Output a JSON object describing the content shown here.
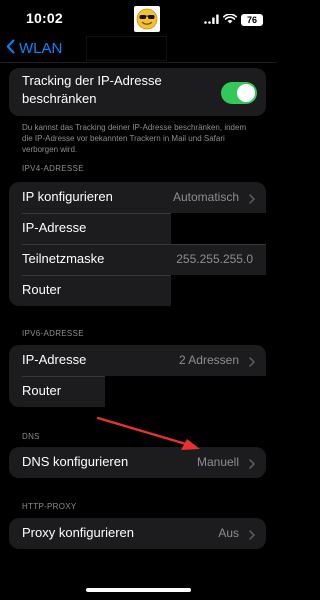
{
  "status_bar": {
    "time": "10:02",
    "emoji_icon": "smiling-face-with-sunglasses",
    "battery": "76"
  },
  "nav": {
    "back_label": "WLAN"
  },
  "tracking": {
    "label": "Tracking der IP-Adresse beschränken",
    "toggle_on": true,
    "footnote": "Du kannst das Tracking deiner IP-Adresse beschränken, indem die IP-Adresse vor bekannten Trackern in Mail und Safari verborgen wird."
  },
  "ipv4": {
    "header": "IPV4-ADRESSE",
    "configure_label": "IP konfigurieren",
    "configure_value": "Automatisch",
    "ip_label": "IP-Adresse",
    "subnet_label": "Teilnetzmaske",
    "subnet_value": "255.255.255.0",
    "router_label": "Router"
  },
  "ipv6": {
    "header": "IPV6-ADRESSE",
    "ip_label": "IP-Adresse",
    "ip_value": "2 Adressen",
    "router_label": "Router"
  },
  "dns": {
    "header": "DNS",
    "configure_label": "DNS konfigurieren",
    "configure_value": "Manuell"
  },
  "proxy": {
    "header": "HTTP-PROXY",
    "configure_label": "Proxy konfigurieren",
    "configure_value": "Aus"
  },
  "colors": {
    "accent": "#0a84ff",
    "toggle_on": "#34c759",
    "annotation_arrow": "#e5322d",
    "cell_bg": "#1c1c1e",
    "secondary_text": "#8d8d93"
  }
}
